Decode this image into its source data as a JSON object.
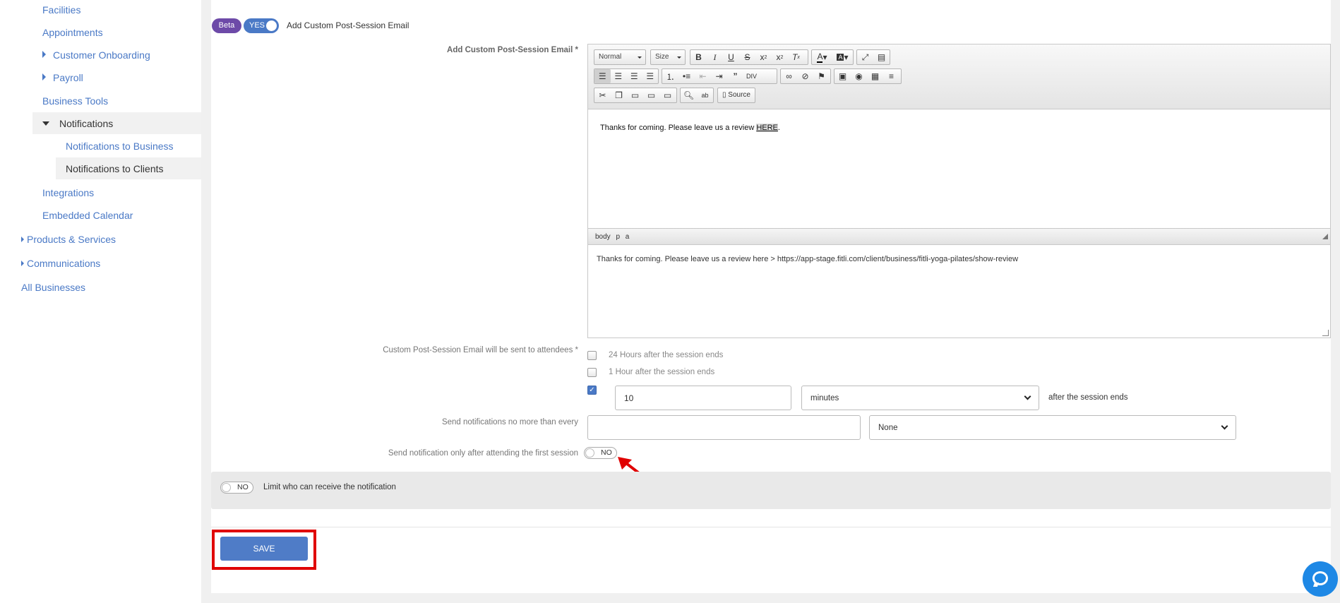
{
  "sidebar": {
    "items": [
      {
        "label": "Facilities"
      },
      {
        "label": "Appointments"
      },
      {
        "label": "Customer Onboarding"
      },
      {
        "label": "Payroll"
      },
      {
        "label": "Business Tools"
      },
      {
        "label": "Notifications"
      },
      {
        "label": "Notifications to Business"
      },
      {
        "label": "Notifications to Clients"
      },
      {
        "label": "Integrations"
      },
      {
        "label": "Embedded Calendar"
      },
      {
        "label": "Products & Services"
      },
      {
        "label": "Communications"
      },
      {
        "label": "All Businesses"
      }
    ]
  },
  "header": {
    "beta_badge": "Beta",
    "toggle_yes": "YES",
    "title": "Add Custom Post-Session Email"
  },
  "editor": {
    "label": "Add Custom Post-Session Email *",
    "format_combo": "Normal",
    "size_combo": "Size",
    "source_label": "Source",
    "content_text": "Thanks for coming. Please leave us a review ",
    "content_link": "HERE",
    "content_suffix": ".",
    "path_bar": "body p a",
    "plain_text": "Thanks for coming. Please leave us a review here > https://app-stage.fitli.com/client/business/fitli-yoga-pilates/show-review"
  },
  "schedule": {
    "label": "Custom Post-Session Email will be sent to attendees *",
    "option_24h": "24 Hours after the session ends",
    "option_1h": "1 Hour after the session ends",
    "option_24h_checked": false,
    "option_1h_checked": false,
    "custom_checked": true,
    "custom_value": "10",
    "custom_unit": "minutes",
    "custom_suffix": "after the session ends"
  },
  "frequency": {
    "label": "Send notifications no more than every",
    "value": "",
    "unit": "None"
  },
  "first_session": {
    "label": "Send notification only after attending the first session",
    "toggle": "NO"
  },
  "limit": {
    "toggle": "NO",
    "label": "Limit who can receive the notification"
  },
  "actions": {
    "save_label": "SAVE"
  },
  "colors": {
    "accent": "#4a79c6",
    "beta": "#6d4aa8",
    "highlight": "#e00000",
    "chat": "#1e88e5"
  }
}
